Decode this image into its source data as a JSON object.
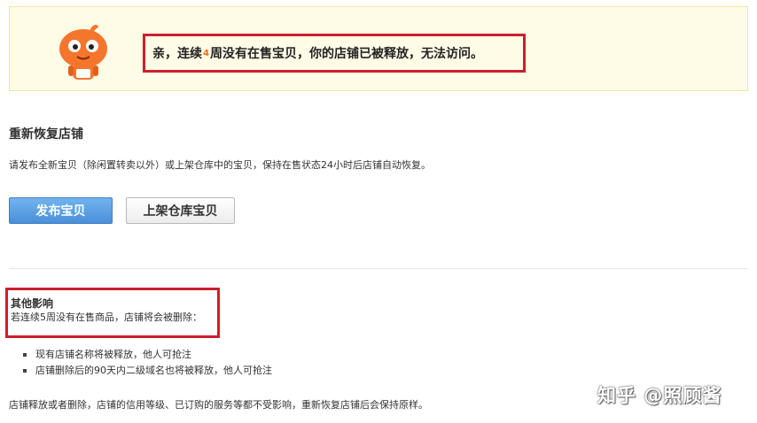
{
  "notice": {
    "text_before": "亲，连续",
    "weeks": "4",
    "text_after": "周没有在售宝贝，你的店铺已被释放，无法访问。",
    "colors": {
      "background": "#fefbe6",
      "highlight_border": "#cc1f2d",
      "weeks_color": "#ff6a00",
      "mascot": "#f4762d"
    }
  },
  "restore": {
    "title": "重新恢复店铺",
    "description": "请发布全新宝贝（除闲置转卖以外）或上架仓库中的宝贝，保持在售状态24小时后店铺自动恢复。",
    "publish_button": "发布宝贝",
    "shelve_button": "上架仓库宝贝"
  },
  "other": {
    "title": "其他影响",
    "description": "若连续5周没有在售商品，店铺将会被删除：",
    "bullets": [
      "现有店铺名称将被释放，他人可抢注",
      "店铺删除后的90天内二级域名也将被释放，他人可抢注"
    ]
  },
  "footer": {
    "text": "店铺释放或者删除，店铺的信用等级、已订购的服务等都不受影响，重新恢复店铺后会保持原样。"
  },
  "watermark": "知乎 @照顾酱"
}
